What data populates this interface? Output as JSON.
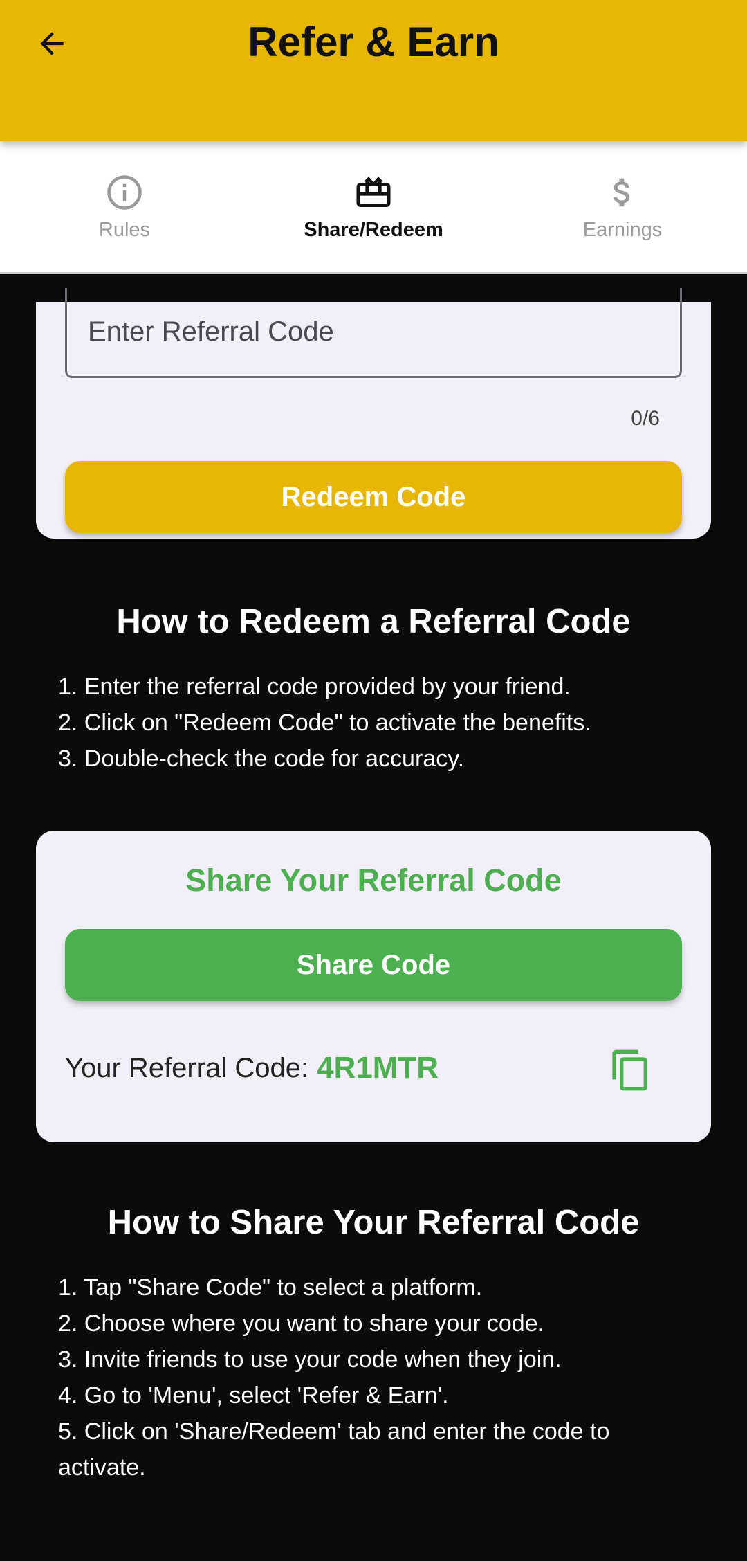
{
  "appbar": {
    "title": "Refer & Earn",
    "back_icon": "arrow-left-icon",
    "color": "#e8b705"
  },
  "tabs": [
    {
      "label": "Rules",
      "icon": "info-circle-icon",
      "active": false
    },
    {
      "label": "Share/Redeem",
      "icon": "gift-card-icon",
      "active": true
    },
    {
      "label": "Earnings",
      "icon": "dollar-icon",
      "active": false
    }
  ],
  "redeem": {
    "input_placeholder": "Enter Referral Code",
    "input_value": "",
    "counter": "0/6",
    "button_label": "Redeem Code"
  },
  "how_redeem": {
    "title": "How to Redeem a Referral Code",
    "steps": [
      "1. Enter the referral code provided by your friend.",
      "2. Click on \"Redeem Code\" to activate the benefits.",
      "3. Double-check the code for accuracy."
    ]
  },
  "share": {
    "title": "Share Your Referral Code",
    "button_label": "Share Code",
    "code_label": "Your Referral Code:",
    "code_value": "4R1MTR",
    "copy_icon": "copy-icon",
    "accent": "#4caf50"
  },
  "how_share": {
    "title": "How to Share Your Referral Code",
    "steps": [
      "1. Tap \"Share Code\" to select a platform.",
      "2. Choose where you want to share your code.",
      "3. Invite friends to use your code when they join.",
      "4. Go to 'Menu', select 'Refer & Earn'.",
      "5. Click on 'Share/Redeem' tab and enter the code to activate."
    ]
  }
}
